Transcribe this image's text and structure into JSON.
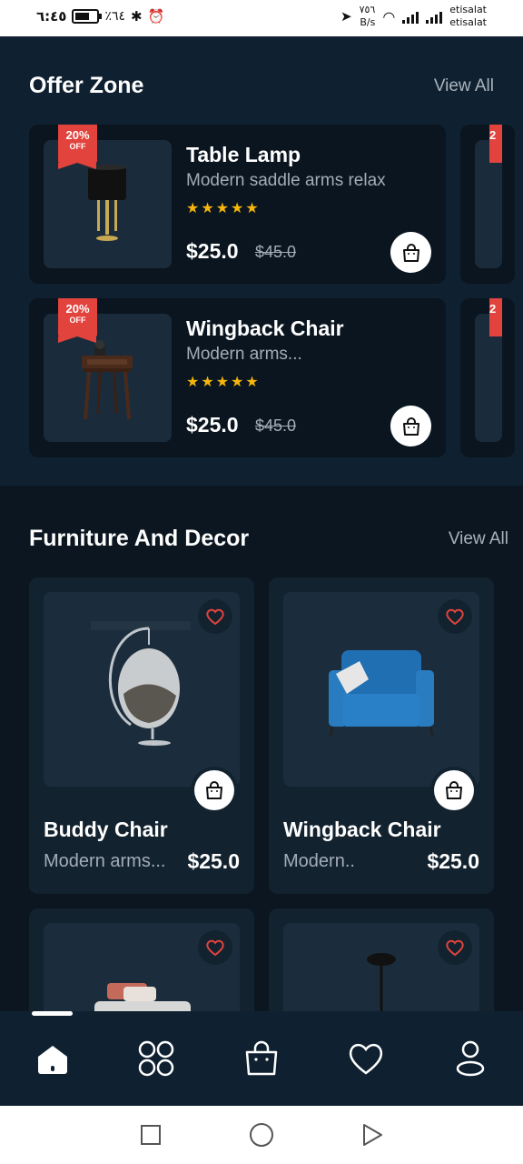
{
  "status_bar": {
    "time": "٦:٤٥",
    "battery": "٪٦٤",
    "battery_level": 0.64,
    "speed": "٧٥٦",
    "speed_unit": "B/s",
    "net": "4G",
    "carrier1": "etisalat",
    "carrier2": "etisalat",
    "volte": "VoLTE"
  },
  "offer_zone": {
    "title": "Offer Zone",
    "view_all": "View All",
    "items": [
      {
        "badge_pct": "20%",
        "badge_off": "OFF",
        "name": "Table Lamp",
        "desc": "Modern saddle arms relax",
        "rating": 5,
        "price": "$25.0",
        "old_price": "$45.0",
        "image": "table-lamp"
      },
      {
        "badge_pct": "20%",
        "badge_off": "OFF",
        "name": "Wingback Chair",
        "desc": "Modern arms...",
        "rating": 5,
        "price": "$25.0",
        "old_price": "$45.0",
        "image": "side-table"
      }
    ],
    "peek_badge": "2"
  },
  "furniture": {
    "title": "Furniture And Decor",
    "view_all": "View All",
    "items": [
      {
        "name": "Buddy Chair",
        "desc": "Modern arms...",
        "price": "$25.0",
        "image": "hanging-egg-chair"
      },
      {
        "name": "Wingback Chair",
        "desc": "Modern..",
        "price": "$25.0",
        "image": "blue-armchair"
      },
      {
        "name": "",
        "desc": "",
        "price": "",
        "image": "bed"
      },
      {
        "name": "",
        "desc": "",
        "price": "",
        "image": "pendant-lamp"
      }
    ]
  },
  "bottom_nav": {
    "items": [
      "home-icon",
      "grid-icon",
      "bag-icon",
      "heart-icon",
      "profile-icon"
    ],
    "active": 0
  },
  "colors": {
    "background": "#0b1621",
    "section": "#0f2130",
    "card": "#0a1520",
    "badge": "#e2433d",
    "star": "#f5b50c",
    "heart": "#e2433d"
  }
}
